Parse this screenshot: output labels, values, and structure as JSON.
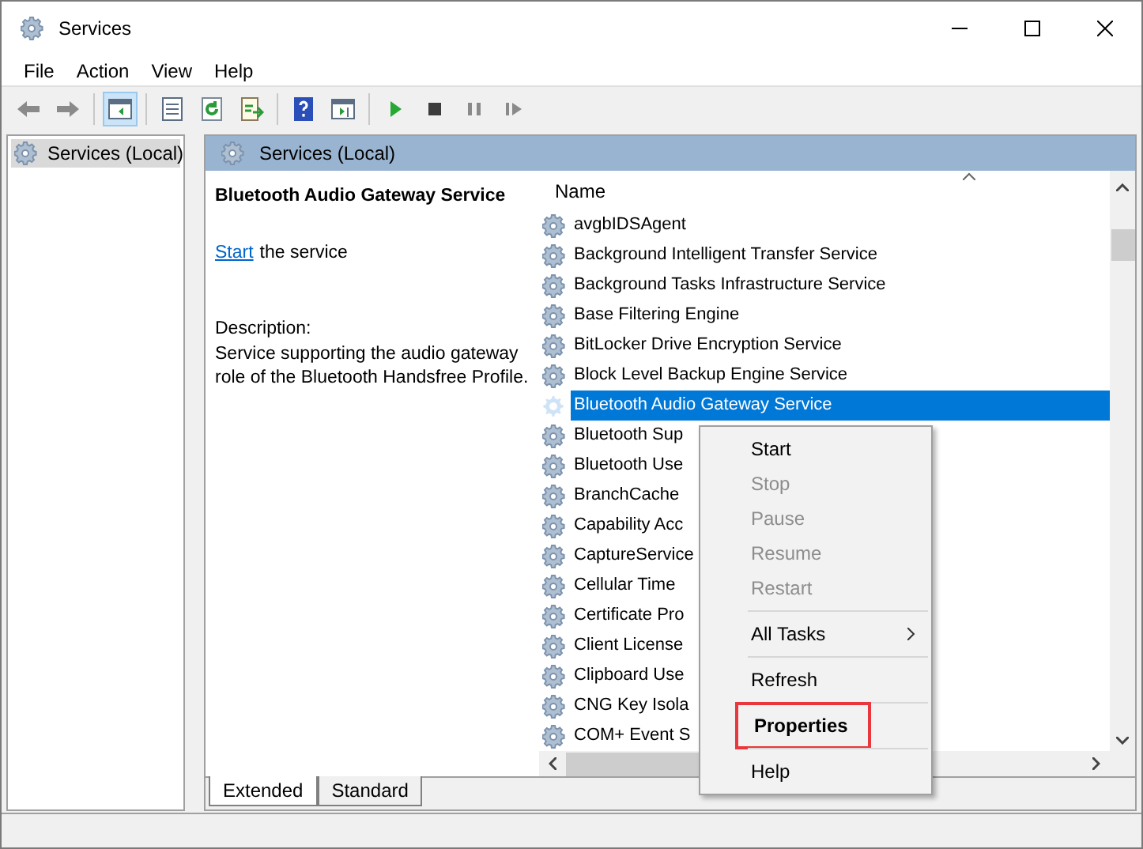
{
  "window": {
    "title": "Services"
  },
  "menu_bar": [
    "File",
    "Action",
    "View",
    "Help"
  ],
  "toolbar": [
    {
      "buttons": [
        {
          "kind": "back",
          "selected": false
        },
        {
          "kind": "forward",
          "selected": false
        }
      ]
    },
    {
      "buttons": [
        {
          "kind": "console-tree",
          "selected": true
        }
      ]
    },
    {
      "buttons": [
        {
          "kind": "properties",
          "selected": false
        },
        {
          "kind": "refresh",
          "selected": false
        },
        {
          "kind": "export",
          "selected": false
        }
      ]
    },
    {
      "buttons": [
        {
          "kind": "help",
          "selected": false
        },
        {
          "kind": "action-pane",
          "selected": false
        }
      ]
    },
    {
      "buttons": [
        {
          "kind": "play",
          "selected": false
        },
        {
          "kind": "stop",
          "selected": false
        },
        {
          "kind": "pause",
          "selected": false
        },
        {
          "kind": "resume",
          "selected": false
        }
      ]
    }
  ],
  "tree": {
    "items": [
      {
        "label": "Services (Local)",
        "selected": true
      }
    ]
  },
  "panel": {
    "title": "Services (Local)",
    "details": {
      "service_name": "Bluetooth Audio Gateway Service",
      "action_link": "Start",
      "action_text": "the service",
      "description_label": "Description:",
      "description": "Service supporting the audio gateway role of the Bluetooth Handsfree Profile."
    },
    "table": {
      "columns": [
        "Name"
      ],
      "rows": [
        {
          "name": "avgbIDSAgent",
          "selected": false
        },
        {
          "name": "Background Intelligent Transfer Service",
          "selected": false
        },
        {
          "name": "Background Tasks Infrastructure Service",
          "selected": false
        },
        {
          "name": "Base Filtering Engine",
          "selected": false
        },
        {
          "name": "BitLocker Drive Encryption Service",
          "selected": false
        },
        {
          "name": "Block Level Backup Engine Service",
          "selected": false
        },
        {
          "name": "Bluetooth Audio Gateway Service",
          "selected": true
        },
        {
          "name": "Bluetooth Sup",
          "selected": false
        },
        {
          "name": "Bluetooth Use",
          "selected": false
        },
        {
          "name": "BranchCache",
          "selected": false
        },
        {
          "name": "Capability Acc",
          "selected": false
        },
        {
          "name": "CaptureService",
          "selected": false
        },
        {
          "name": "Cellular Time",
          "selected": false
        },
        {
          "name": "Certificate Pro",
          "selected": false
        },
        {
          "name": "Client License",
          "selected": false
        },
        {
          "name": "Clipboard Use",
          "selected": false
        },
        {
          "name": "CNG Key Isola",
          "selected": false
        },
        {
          "name": "COM+ Event S",
          "selected": false
        }
      ]
    },
    "tabs": [
      {
        "label": "Extended",
        "selected": true
      },
      {
        "label": "Standard",
        "selected": false
      }
    ]
  },
  "context_menu": [
    {
      "kind": "item",
      "label": "Start",
      "disabled": false,
      "default": false,
      "highlighted": false,
      "submenu": false
    },
    {
      "kind": "item",
      "label": "Stop",
      "disabled": true,
      "default": false,
      "highlighted": false,
      "submenu": false
    },
    {
      "kind": "item",
      "label": "Pause",
      "disabled": true,
      "default": false,
      "highlighted": false,
      "submenu": false
    },
    {
      "kind": "item",
      "label": "Resume",
      "disabled": true,
      "default": false,
      "highlighted": false,
      "submenu": false
    },
    {
      "kind": "item",
      "label": "Restart",
      "disabled": true,
      "default": false,
      "highlighted": false,
      "submenu": false
    },
    {
      "kind": "separator"
    },
    {
      "kind": "item",
      "label": "All Tasks",
      "disabled": false,
      "default": false,
      "highlighted": false,
      "submenu": true
    },
    {
      "kind": "separator"
    },
    {
      "kind": "item",
      "label": "Refresh",
      "disabled": false,
      "default": false,
      "highlighted": false,
      "submenu": false
    },
    {
      "kind": "separator"
    },
    {
      "kind": "item",
      "label": "Properties",
      "disabled": false,
      "default": true,
      "highlighted": true,
      "submenu": false
    },
    {
      "kind": "separator"
    },
    {
      "kind": "item",
      "label": "Help",
      "disabled": false,
      "default": false,
      "highlighted": false,
      "submenu": false
    }
  ]
}
